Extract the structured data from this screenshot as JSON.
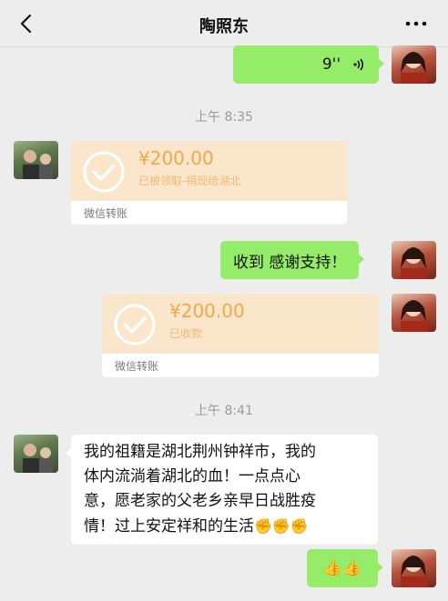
{
  "header": {
    "title": "陶照东"
  },
  "messages": {
    "voice_duration": "9''",
    "time_1": "上午 8:35",
    "transfer_1": {
      "amount": "¥200.00",
      "status": "已被领取-捐现给湖北",
      "footer": "微信转账"
    },
    "text_reply": "收到 感谢支持！",
    "transfer_2": {
      "amount": "¥200.00",
      "status": "已收款",
      "footer": "微信转账"
    },
    "time_2": "上午 8:41",
    "long_text_lines": [
      "我的祖籍是湖北荆州钟祥市，我的",
      "体内流淌着湖北的血！一点点心",
      "意，愿老家的父老乡亲早日战胜疫",
      "情！过上安定祥和的生活"
    ],
    "long_text_emoji": "✊✊✊",
    "thumbs": "👍👍"
  },
  "colors": {
    "green_bubble": "#95ec69",
    "transfer_bg": "#fae7cb",
    "amount": "#f3a64c",
    "background": "#ededed"
  },
  "icons": [
    "chevron-left-icon",
    "more-dots-icon",
    "voice-wave-icon",
    "check-circle-icon"
  ]
}
